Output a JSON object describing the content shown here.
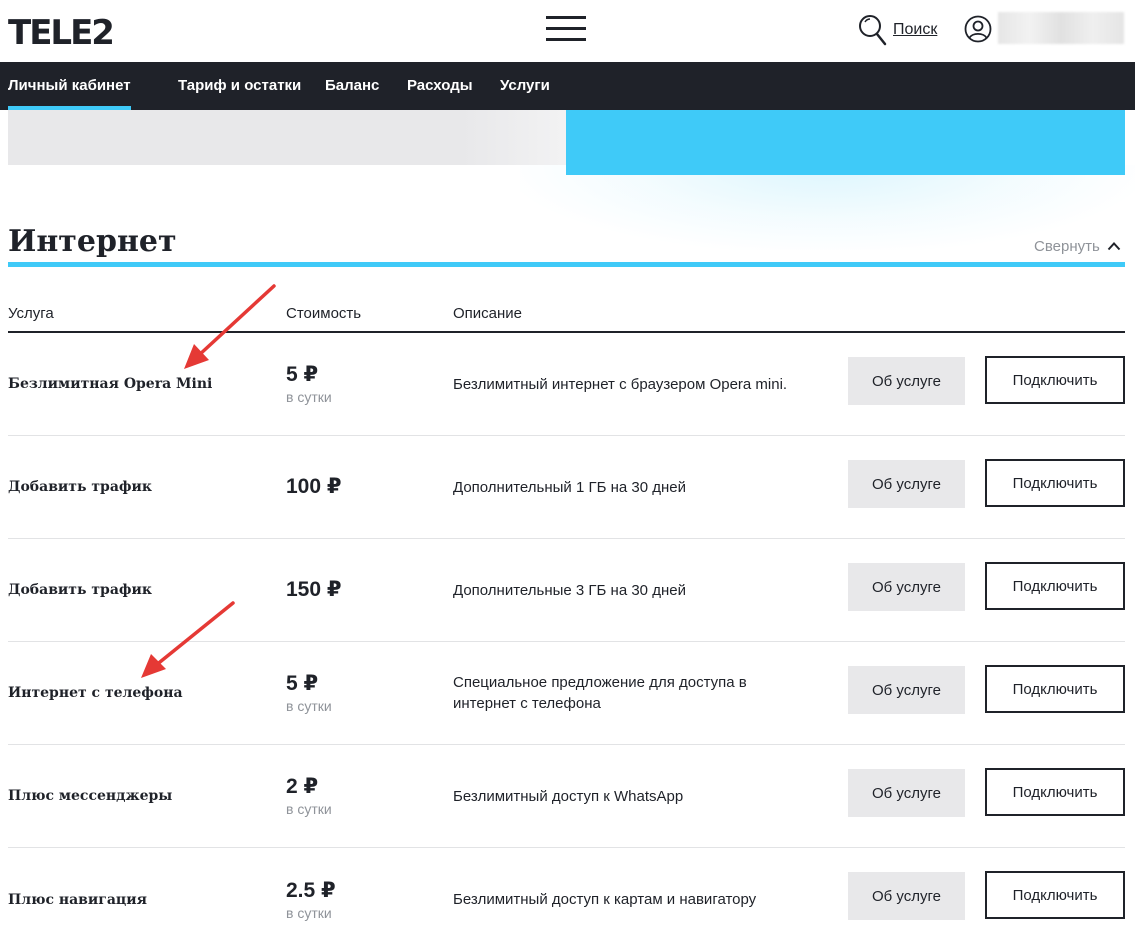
{
  "header": {
    "logo": "TELE2",
    "search_label": "Поиск"
  },
  "nav": {
    "items": [
      {
        "label": "Личный кабинет",
        "active": true
      },
      {
        "label": "Тариф и остатки"
      },
      {
        "label": "Баланс"
      },
      {
        "label": "Расходы"
      },
      {
        "label": "Услуги"
      }
    ]
  },
  "section": {
    "title": "Интернет",
    "collapse_label": "Свернуть"
  },
  "table": {
    "columns": [
      "Услуга",
      "Стоимость",
      "Описание"
    ],
    "info_button_label": "Об услуге",
    "connect_button_label": "Подключить",
    "rows": [
      {
        "name": "Безлимитная Opera Mini",
        "price": "5 ₽",
        "period": "в сутки",
        "description": "Безлимитный интернет с браузером Opera mini."
      },
      {
        "name": "Добавить трафик",
        "price": "100 ₽",
        "period": "",
        "description": "Дополнительный 1 ГБ на 30 дней"
      },
      {
        "name": "Добавить трафик",
        "price": "150 ₽",
        "period": "",
        "description": "Дополнительные 3 ГБ на 30 дней"
      },
      {
        "name": "Интернет с телефона",
        "price": "5 ₽",
        "period": "в сутки",
        "description": "Специальное предложение для доступа в интернет с телефона"
      },
      {
        "name": "Плюс мессенджеры",
        "price": "2 ₽",
        "period": "в сутки",
        "description": "Безлимитный доступ к WhatsApp"
      },
      {
        "name": "Плюс навигация",
        "price": "2.5 ₽",
        "period": "в сутки",
        "description": "Безлимитный доступ к картам и навигатору"
      }
    ]
  },
  "icons": {
    "menu": "hamburger-menu-icon",
    "search": "search-icon",
    "user": "user-icon",
    "collapse": "chevron-up-icon",
    "annotation": "red-arrow-icon"
  },
  "colors": {
    "brand_dark": "#1f2229",
    "accent_blue": "#3fcaf8",
    "button_grey": "#e8e8ea",
    "muted_text": "#8f9399",
    "annotation_red": "#e53935"
  }
}
